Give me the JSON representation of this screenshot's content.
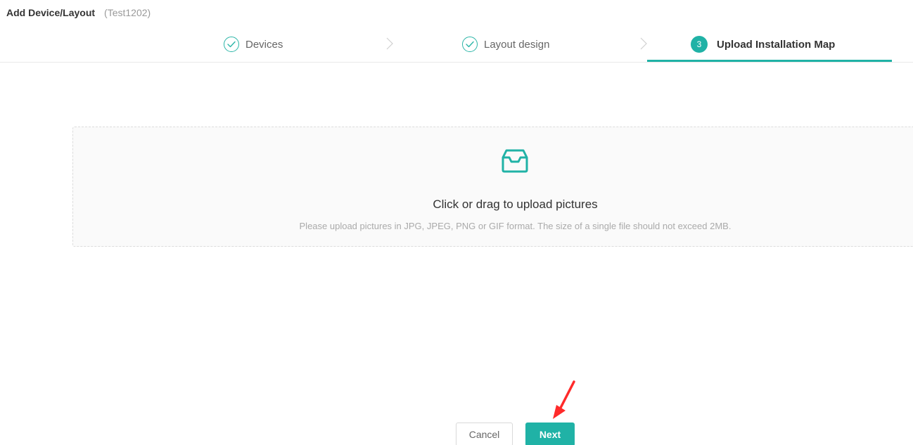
{
  "header": {
    "title": "Add Device/Layout",
    "subtitle": "(Test1202)"
  },
  "steps": [
    {
      "label": "Devices",
      "status": "done",
      "icon": "check-circle-icon"
    },
    {
      "label": "Layout design",
      "status": "done",
      "icon": "check-circle-icon"
    },
    {
      "label": "Upload Installation Map",
      "status": "active",
      "number": "3"
    }
  ],
  "upload": {
    "icon": "inbox-icon",
    "main_text": "Click or drag to upload pictures",
    "hint_text": "Please upload pictures in JPG, JPEG, PNG or GIF format. The size of a single file should not exceed 2MB."
  },
  "footer": {
    "cancel_label": "Cancel",
    "next_label": "Next"
  },
  "colors": {
    "accent": "#20b2a6",
    "annotation_arrow": "#ff2a2a"
  }
}
